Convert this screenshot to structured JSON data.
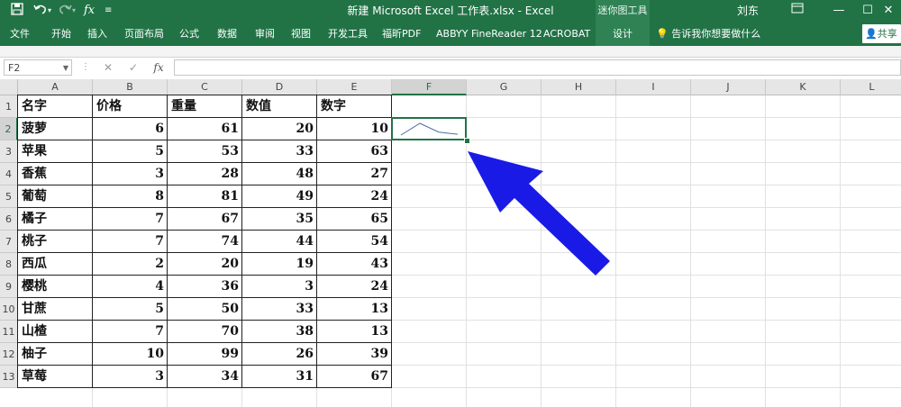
{
  "window": {
    "title": "新建 Microsoft Excel 工作表.xlsx  -  Excel",
    "context_tab_label": "迷你图工具",
    "user_name": "刘东"
  },
  "quick_access": {
    "save_icon": "save-icon",
    "undo_icon": "undo-icon",
    "redo_icon": "redo-icon",
    "fx_glyph": "fx",
    "more_icon": "more-icon"
  },
  "window_controls": {
    "restore_icon": "ribbon-display-icon",
    "minimize_glyph": "—",
    "maximize_glyph": "☐",
    "close_glyph": "✕"
  },
  "ribbon": {
    "tabs": [
      "文件",
      "开始",
      "插入",
      "页面布局",
      "公式",
      "数据",
      "审阅",
      "视图",
      "开发工具",
      "福昕PDF",
      "ABBYY FineReader 12",
      "ACROBAT",
      "设计"
    ],
    "tell_me": "告诉我你想要做什么",
    "share": "共享"
  },
  "formula_bar": {
    "name_box": "F2",
    "cancel_glyph": "✕",
    "enter_glyph": "✓",
    "fx_glyph": "fx",
    "formula": ""
  },
  "sheet": {
    "columns": [
      "A",
      "B",
      "C",
      "D",
      "E",
      "F",
      "G",
      "H",
      "I",
      "J",
      "K",
      "L"
    ],
    "rows": [
      "1",
      "2",
      "3",
      "4",
      "5",
      "6",
      "7",
      "8",
      "9",
      "10",
      "11",
      "12",
      "13"
    ],
    "header": [
      "名字",
      "价格",
      "重量",
      "数值",
      "数字"
    ],
    "data": [
      [
        "菠萝",
        "6",
        "61",
        "20",
        "10"
      ],
      [
        "苹果",
        "5",
        "53",
        "33",
        "63"
      ],
      [
        "香蕉",
        "3",
        "28",
        "48",
        "27"
      ],
      [
        "葡萄",
        "8",
        "81",
        "49",
        "24"
      ],
      [
        "橘子",
        "7",
        "67",
        "35",
        "65"
      ],
      [
        "桃子",
        "7",
        "74",
        "44",
        "54"
      ],
      [
        "西瓜",
        "2",
        "20",
        "19",
        "43"
      ],
      [
        "樱桃",
        "4",
        "36",
        "3",
        "24"
      ],
      [
        "甘蔗",
        "5",
        "50",
        "33",
        "13"
      ],
      [
        "山楂",
        "7",
        "70",
        "38",
        "13"
      ],
      [
        "柚子",
        "10",
        "99",
        "26",
        "39"
      ],
      [
        "草莓",
        "3",
        "34",
        "31",
        "67"
      ]
    ],
    "selected_cell": "F2",
    "sparkline": {
      "cell": "F2",
      "type": "line",
      "values": [
        6,
        61,
        20,
        10
      ],
      "color": "#4a6fa5"
    }
  },
  "colors": {
    "excel_green": "#217346",
    "annotation_arrow": "#1a1ae6"
  }
}
